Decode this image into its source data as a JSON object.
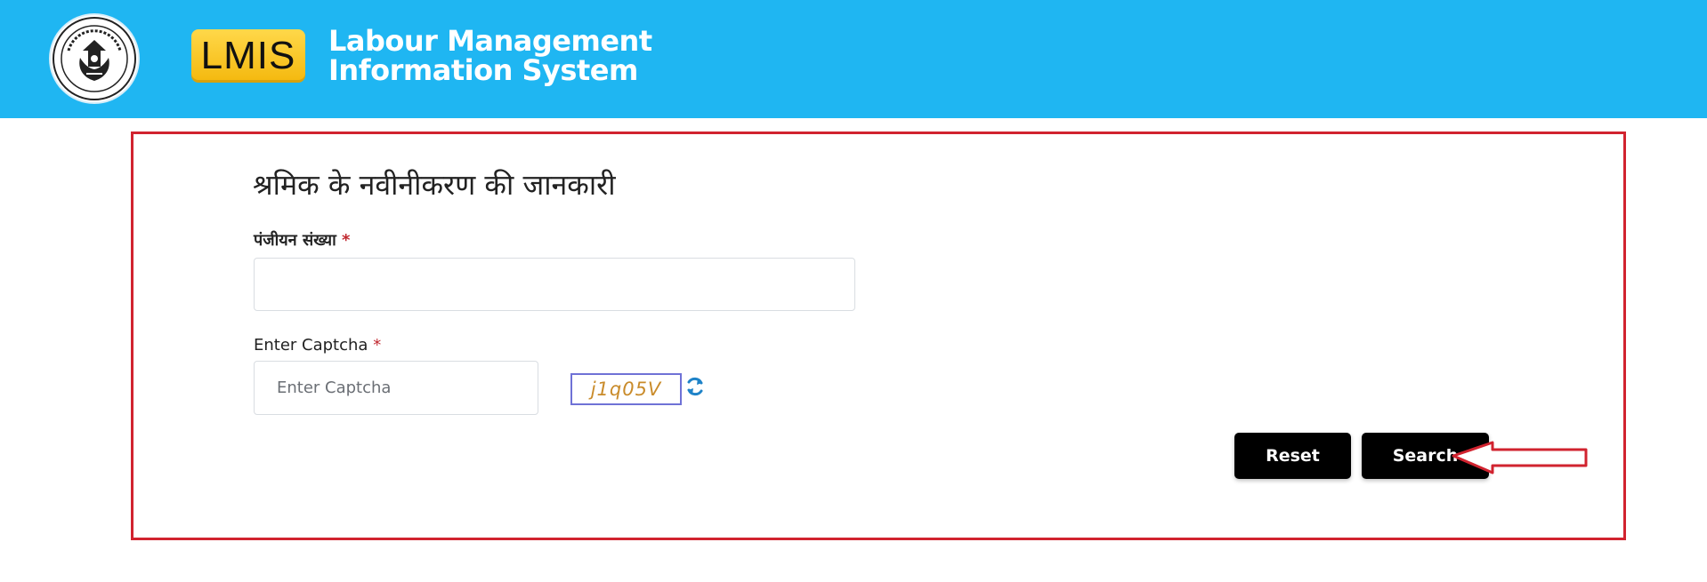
{
  "header": {
    "seal_icon": "up-government-seal-icon",
    "logo_text": "LMIS",
    "brand_line1": "Labour Management",
    "brand_line2": "Information System",
    "background_color": "#1fb6f2",
    "logo_color": "#f9c623"
  },
  "form": {
    "title": "श्रमिक के नवीनीकरण की जानकारी",
    "registration": {
      "label": "पंजीयन संख्या",
      "required_mark": "*",
      "value": "",
      "placeholder": ""
    },
    "captcha": {
      "label": "Enter Captcha",
      "required_mark": "*",
      "value": "",
      "placeholder": "Enter Captcha",
      "code": "j1q05V",
      "refresh_icon": "refresh-icon"
    },
    "buttons": {
      "reset": "Reset",
      "search": "Search"
    },
    "highlight_color": "#d1232f",
    "annotation_icon": "red-arrow-icon"
  }
}
